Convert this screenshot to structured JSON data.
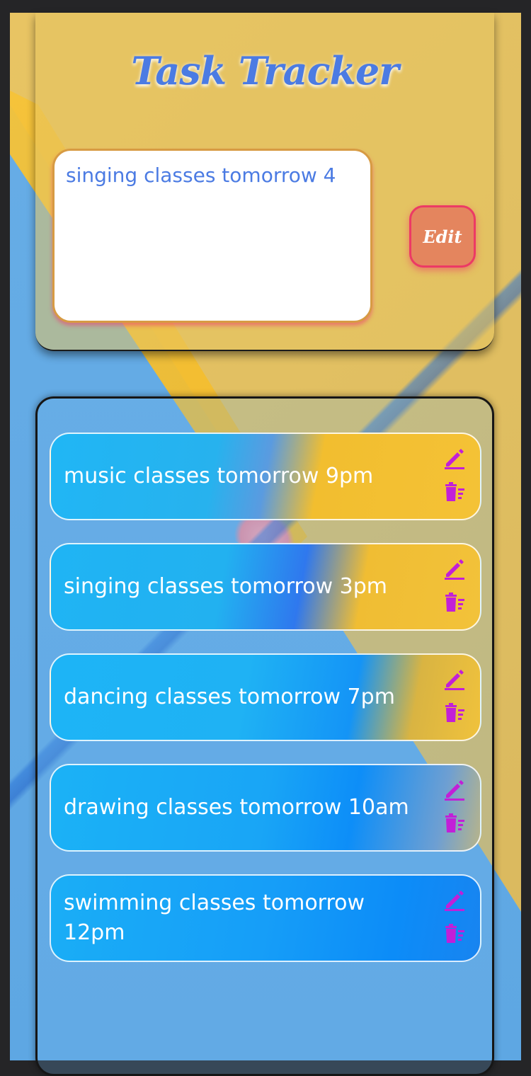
{
  "header": {
    "title": "Task Tracker"
  },
  "task_input": {
    "value": "singing classes tomorrow 4"
  },
  "edit_button": {
    "label": "Edit"
  },
  "tasks": [
    {
      "text": "music classes tomorrow 9pm"
    },
    {
      "text": "singing classes tomorrow 3pm"
    },
    {
      "text": "dancing classes tomorrow 7pm"
    },
    {
      "text": "drawing classes tomorrow 10am"
    },
    {
      "text": "swimming classes tomorrow 12pm"
    }
  ],
  "icons": {
    "edit": "pencil-icon",
    "delete": "trash-icon"
  },
  "colors": {
    "title": "#4b7be3",
    "icon": "#c21fd8",
    "edit_button_bg": "#e4855e",
    "edit_button_border": "#ec3a65"
  }
}
